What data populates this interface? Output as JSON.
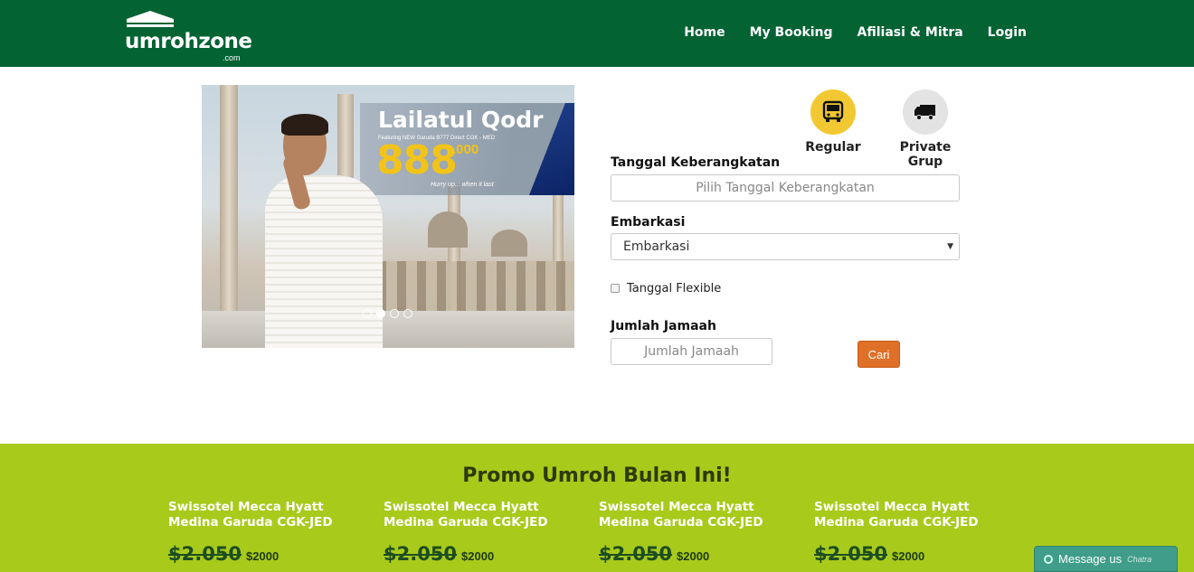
{
  "header": {
    "logo_text": "umrohzone",
    "logo_suffix": ".com",
    "nav": [
      "Home",
      "My Booking",
      "Afiliasi & Mitra",
      "Login"
    ]
  },
  "carousel": {
    "banner_title": "Lailatul Qodr",
    "banner_subtitle": "Featuring NEW Garuda B777 Direct CGK - MED",
    "banner_price": "888",
    "banner_price_suffix": ".000",
    "banner_tagline": "Hurry up... when it last",
    "active_slide": 2,
    "slide_count": 4
  },
  "booking": {
    "types": [
      {
        "label": "Regular",
        "icon": "bus-icon",
        "color": "#f2c832"
      },
      {
        "label": "Private Grup",
        "icon": "truck-icon",
        "color": "#e3e3e3"
      }
    ],
    "date_label": "Tanggal Keberangkatan",
    "date_placeholder": "Pilih Tanggal Keberangkatan",
    "embarkasi_label": "Embarkasi",
    "embarkasi_value": "Embarkasi",
    "flexible_label": "Tanggal Flexible",
    "jamaah_label": "Jumlah Jamaah",
    "jamaah_placeholder": "Jumlah Jamaah",
    "search_button": "Cari"
  },
  "promo": {
    "title": "Promo Umroh Bulan Ini!",
    "cards": [
      {
        "title": "Swissotel Mecca Hyatt Medina Garuda CGK-JED",
        "old_price": "$2.050",
        "new_price": "$2000"
      },
      {
        "title": "Swissotel Mecca Hyatt Medina Garuda CGK-JED",
        "old_price": "$2.050",
        "new_price": "$2000"
      },
      {
        "title": "Swissotel Mecca Hyatt Medina Garuda CGK-JED",
        "old_price": "$2.050",
        "new_price": "$2000"
      },
      {
        "title": "Swissotel Mecca Hyatt Medina Garuda CGK-JED",
        "old_price": "$2.050",
        "new_price": "$2000"
      }
    ]
  },
  "chat": {
    "label": "Message us",
    "brand": "Chatra"
  },
  "colors": {
    "header": "#046333",
    "promo_bg": "#a8ca1b",
    "button": "#df7027"
  }
}
